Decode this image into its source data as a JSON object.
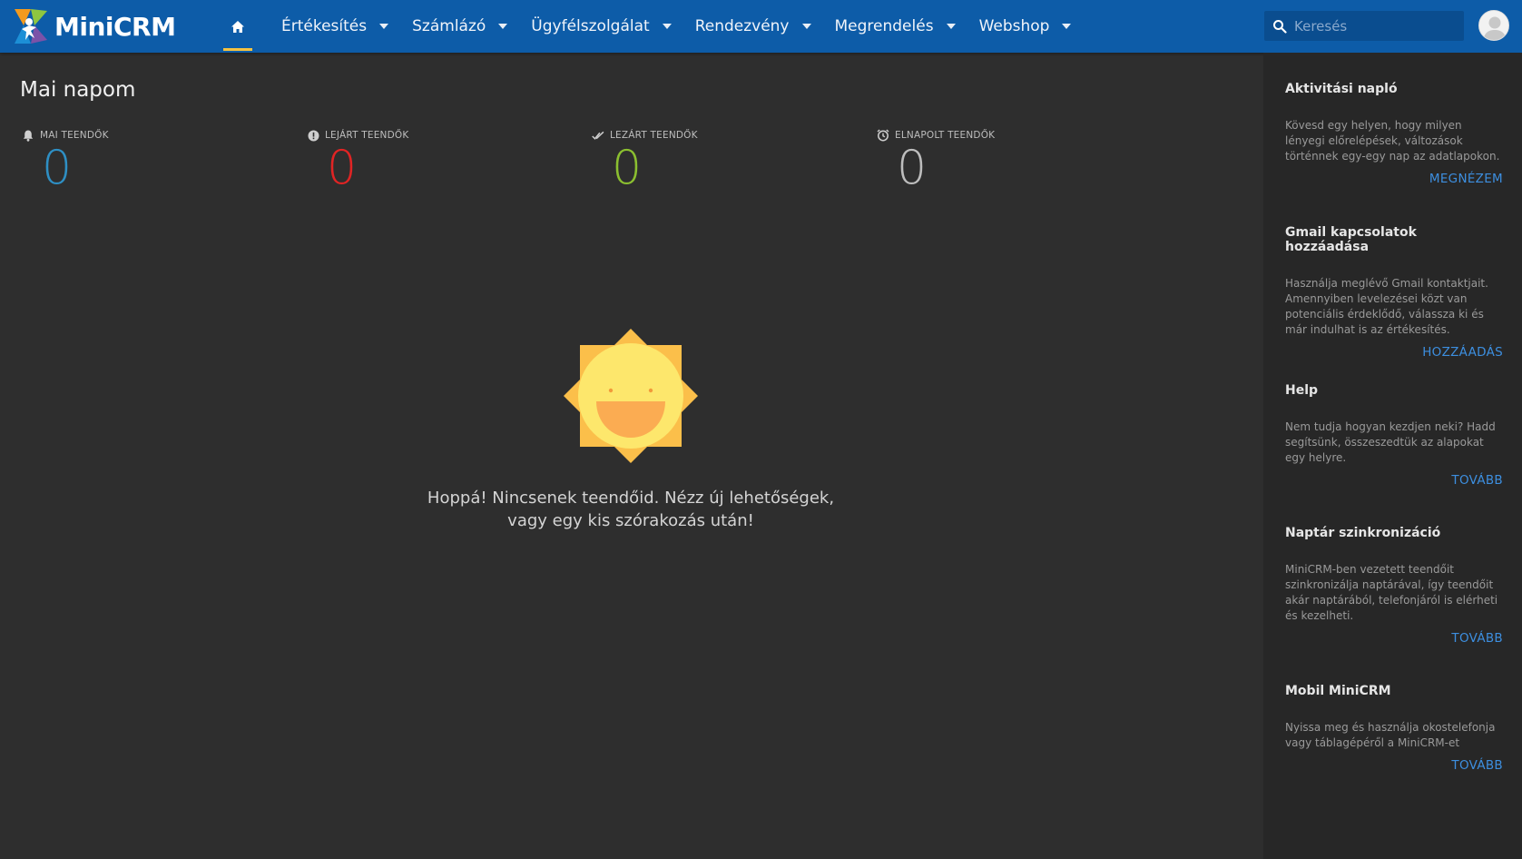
{
  "app": {
    "logo_text": "MiniCRM"
  },
  "nav": {
    "items": [
      {
        "label": "Értékesítés"
      },
      {
        "label": "Számlázó"
      },
      {
        "label": "Ügyfélszolgálat"
      },
      {
        "label": "Rendezvény"
      },
      {
        "label": "Megrendelés"
      },
      {
        "label": "Webshop"
      }
    ]
  },
  "search": {
    "placeholder": "Keresés",
    "value": ""
  },
  "main": {
    "title": "Mai napom",
    "stats": [
      {
        "label": "MAI TEENDŐK",
        "value": "0",
        "color": "#2e8fc4",
        "icon": "bell-icon"
      },
      {
        "label": "LEJÁRT TEENDŐK",
        "value": "0",
        "color": "#e02424",
        "icon": "alert-icon"
      },
      {
        "label": "LEZÁRT TEENDŐK",
        "value": "0",
        "color": "#8bbf30",
        "icon": "double-check-icon"
      },
      {
        "label": "ELNAPOLT TEENDŐK",
        "value": "0",
        "color": "#bdbdbd",
        "icon": "alarm-clock-icon"
      }
    ],
    "empty_line1": "Hoppá! Nincsenek teendőid. Nézz új lehetőségek,",
    "empty_line2": "vagy egy kis szórakozás után!"
  },
  "sidebar": {
    "cards": [
      {
        "title": "Aktivitási napló",
        "text": "Kövesd egy helyen, hogy milyen lényegi előrelépések, változások történnek egy-egy nap az adatlapokon.",
        "link": "MEGNÉZEM"
      },
      {
        "title": "Gmail kapcsolatok hozzáadása",
        "text": "Használja meglévő Gmail kontaktjait. Amennyiben levelezései közt van potenciális érdeklődő, válassza ki és már indulhat is az értékesítés.",
        "link": "HOZZÁADÁS"
      },
      {
        "title": "Help",
        "text": "Nem tudja hogyan kezdjen neki? Hadd segítsünk, összeszedtük az alapokat egy helyre.",
        "link": "TOVÁBB"
      },
      {
        "title": "Naptár szinkronizáció",
        "text": "MiniCRM-ben vezetett teendőit szinkronizálja naptárával, így teendőit akár naptárából, telefonjáról is elérheti és kezelheti.",
        "link": "TOVÁBB"
      },
      {
        "title": "Mobil MiniCRM",
        "text": "Nyissa meg és használja okostelefonja vagy táblagépéről a MiniCRM-et",
        "link": "TOVÁBB"
      }
    ]
  },
  "colors": {
    "topbar": "#0d5ca8",
    "accent_underline": "#f5c242",
    "link": "#3d8fe0",
    "background": "#2e2e2e",
    "sidebar": "#272727"
  }
}
